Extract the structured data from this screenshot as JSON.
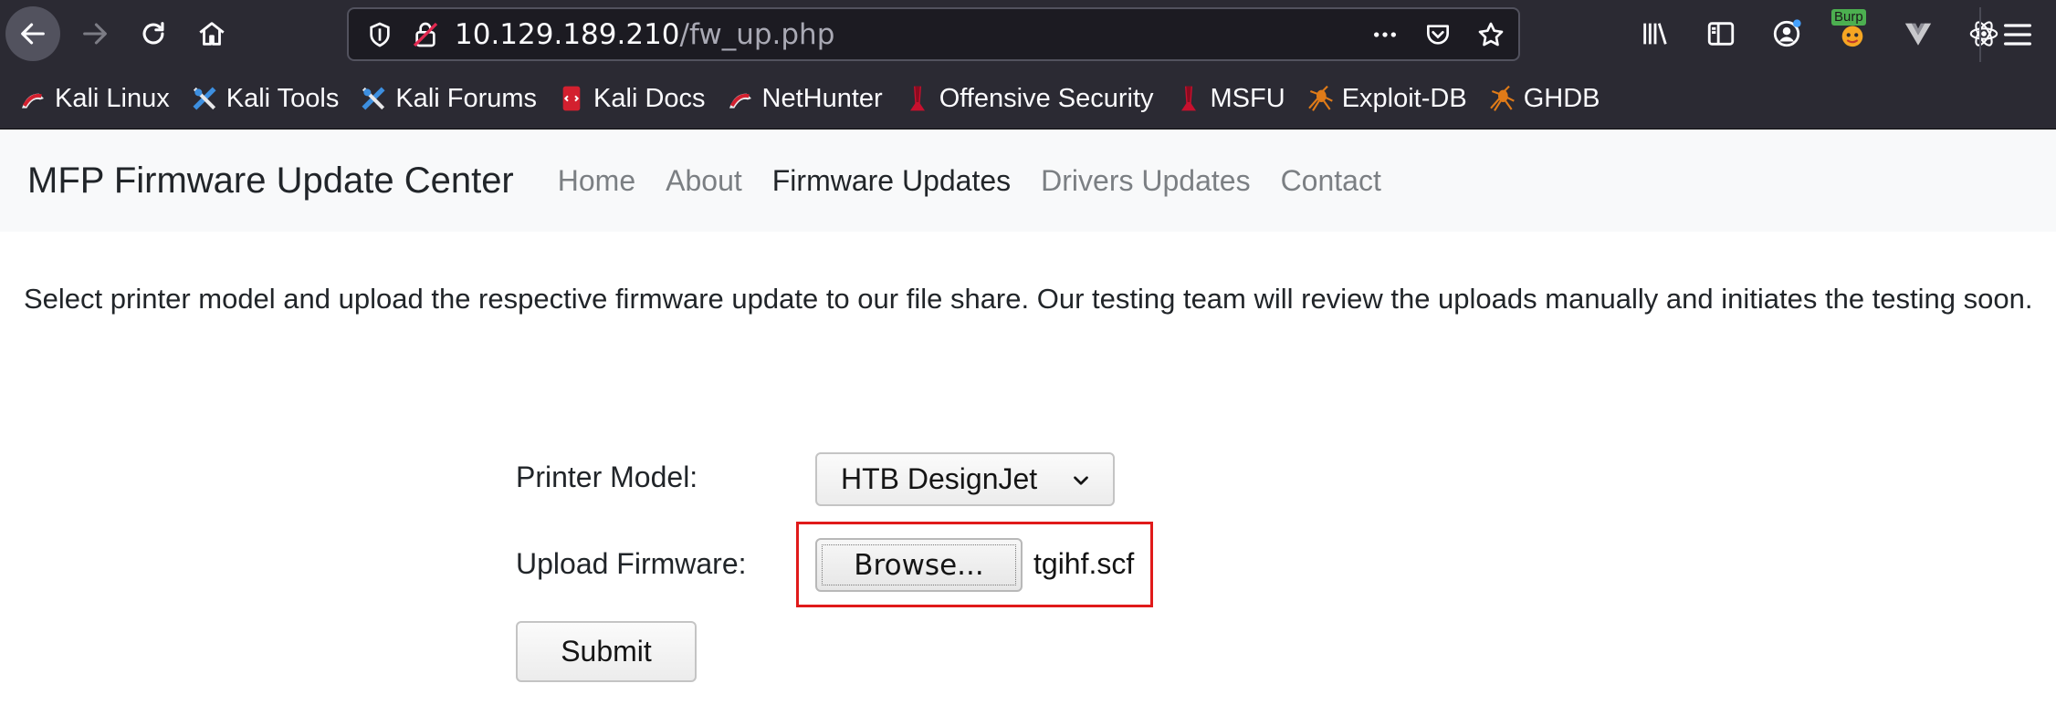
{
  "browser": {
    "url_host": "10.129.189.210",
    "url_path": "/fw_up.php",
    "burp_label": "Burp",
    "bookmarks": [
      {
        "label": "Kali Linux",
        "icon": "kali-dragon-icon"
      },
      {
        "label": "Kali Tools",
        "icon": "kali-tools-icon"
      },
      {
        "label": "Kali Forums",
        "icon": "kali-forums-icon"
      },
      {
        "label": "Kali Docs",
        "icon": "kali-docs-icon"
      },
      {
        "label": "NetHunter",
        "icon": "kali-dragon-icon"
      },
      {
        "label": "Offensive Security",
        "icon": "offsec-icon"
      },
      {
        "label": "MSFU",
        "icon": "offsec-icon"
      },
      {
        "label": "Exploit-DB",
        "icon": "exploit-db-spider-icon"
      },
      {
        "label": "GHDB",
        "icon": "exploit-db-spider-icon"
      }
    ],
    "colors": {
      "chrome": "#2b2a33",
      "urlbar": "#1c1b22"
    }
  },
  "site": {
    "brand": "MFP Firmware Update Center",
    "nav": [
      {
        "label": "Home",
        "active": false
      },
      {
        "label": "About",
        "active": false
      },
      {
        "label": "Firmware Updates",
        "active": true
      },
      {
        "label": "Drivers Updates",
        "active": false
      },
      {
        "label": "Contact",
        "active": false
      }
    ]
  },
  "main": {
    "intro": "Select printer model and upload the respective firmware update to our file share. Our testing team will review the uploads manually and initiates the testing soon.",
    "form": {
      "model_label": "Printer Model:",
      "model_value": "HTB DesignJet",
      "upload_label": "Upload Firmware:",
      "browse_label": "Browse...",
      "selected_file": "tgihf.scf",
      "submit_label": "Submit"
    },
    "highlight_color": "#e01a1a"
  }
}
